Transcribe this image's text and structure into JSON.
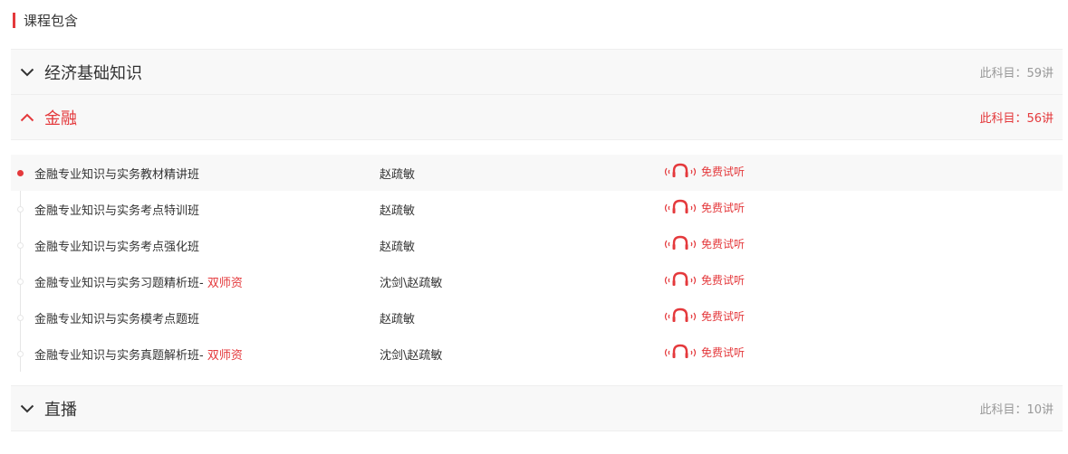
{
  "header": {
    "title": "课程包含"
  },
  "subjects": [
    {
      "name": "经济基础知识",
      "count": "此科目：59讲",
      "expanded": false
    },
    {
      "name": "金融",
      "count": "此科目：56讲",
      "expanded": true
    },
    {
      "name": "直播",
      "count": "此科目：10讲",
      "expanded": false
    }
  ],
  "lessons": [
    {
      "name": "金融专业知识与实务教材精讲班",
      "tag": "",
      "teacher": "赵疏敏",
      "trial": "免费试听"
    },
    {
      "name": "金融专业知识与实务考点特训班",
      "tag": "",
      "teacher": "赵疏敏",
      "trial": "免费试听"
    },
    {
      "name": "金融专业知识与实务考点强化班",
      "tag": "",
      "teacher": "赵疏敏",
      "trial": "免费试听"
    },
    {
      "name": "金融专业知识与实务习题精析班-",
      "tag": " 双师资",
      "teacher": "沈剑\\赵疏敏",
      "trial": "免费试听"
    },
    {
      "name": "金融专业知识与实务模考点题班",
      "tag": "",
      "teacher": "赵疏敏",
      "trial": "免费试听"
    },
    {
      "name": "金融专业知识与实务真题解析班-",
      "tag": " 双师资",
      "teacher": "沈剑\\赵疏敏",
      "trial": "免费试听"
    }
  ],
  "colors": {
    "accent": "#e4393c",
    "muted": "#999999",
    "text": "#333333"
  },
  "icons": {
    "collapsed": "chevron-down-icon",
    "expanded": "chevron-up-icon",
    "trial": "headphones-icon"
  }
}
